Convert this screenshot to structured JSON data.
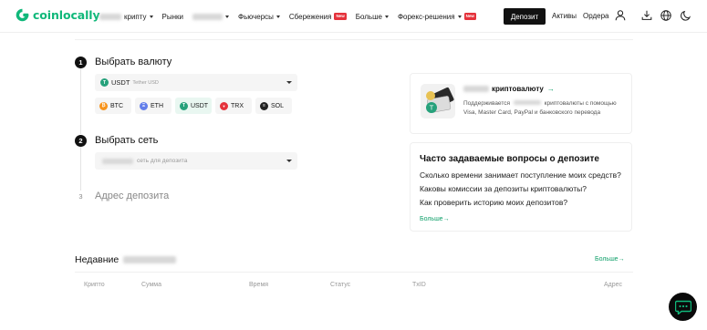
{
  "header": {
    "logo_text": "coinlocally",
    "nav": [
      {
        "label": "крипту",
        "has_caret": true
      },
      {
        "label": "Рынки"
      },
      {
        "label": "",
        "has_caret": true
      },
      {
        "label": "Фьючерсы",
        "has_caret": true
      },
      {
        "label": "Сбережения",
        "badge": "New"
      },
      {
        "label": "Больше",
        "has_caret": true
      },
      {
        "label": "Форекс-решения",
        "has_caret": true,
        "badge": "New"
      }
    ],
    "deposit_button": "Депозит",
    "assets_link": "Активы",
    "orders_link": "Ордера"
  },
  "steps": [
    {
      "num": "1",
      "title": "Выбрать валюту"
    },
    {
      "num": "2",
      "title": "Выбрать сеть"
    },
    {
      "num": "3",
      "title": "Адрес депозита"
    }
  ],
  "currency_select": {
    "symbol": "USDT",
    "name": "Tether USD"
  },
  "coins": [
    {
      "symbol": "BTC",
      "color": "#f7931a",
      "glyph": "₿"
    },
    {
      "symbol": "ETH",
      "color": "#627eea",
      "glyph": "Ξ"
    },
    {
      "symbol": "USDT",
      "color": "#26a17b",
      "glyph": "T"
    },
    {
      "symbol": "TRX",
      "color": "#e5323b",
      "glyph": "▼"
    },
    {
      "symbol": "SOL",
      "color": "#222222",
      "glyph": "≡"
    }
  ],
  "network_select": {
    "placeholder": "сеть для депозита"
  },
  "promo": {
    "title": "криптовалюту",
    "arrow": "→",
    "desc_prefix": "Поддерживается",
    "desc_suffix": "криптовалюты с помощью Visa, Master Card, PayPal и банковского перевода"
  },
  "faq": {
    "title": "Часто задаваемые вопросы о депозите",
    "questions": [
      "Сколько времени занимает поступление моих средств?",
      "Каковы комиссии за депозиты криптовалюты?",
      "Как проверить историю моих депозитов?"
    ],
    "more": "Больше→"
  },
  "recent": {
    "title": "Недавние",
    "more": "Больше→",
    "columns": [
      "Крипто",
      "Сумма",
      "Время",
      "Статус",
      "TxID",
      "Адрес"
    ]
  },
  "colors": {
    "brand": "#10b87a",
    "link": "#10a06a",
    "badge": "#e5323b"
  }
}
